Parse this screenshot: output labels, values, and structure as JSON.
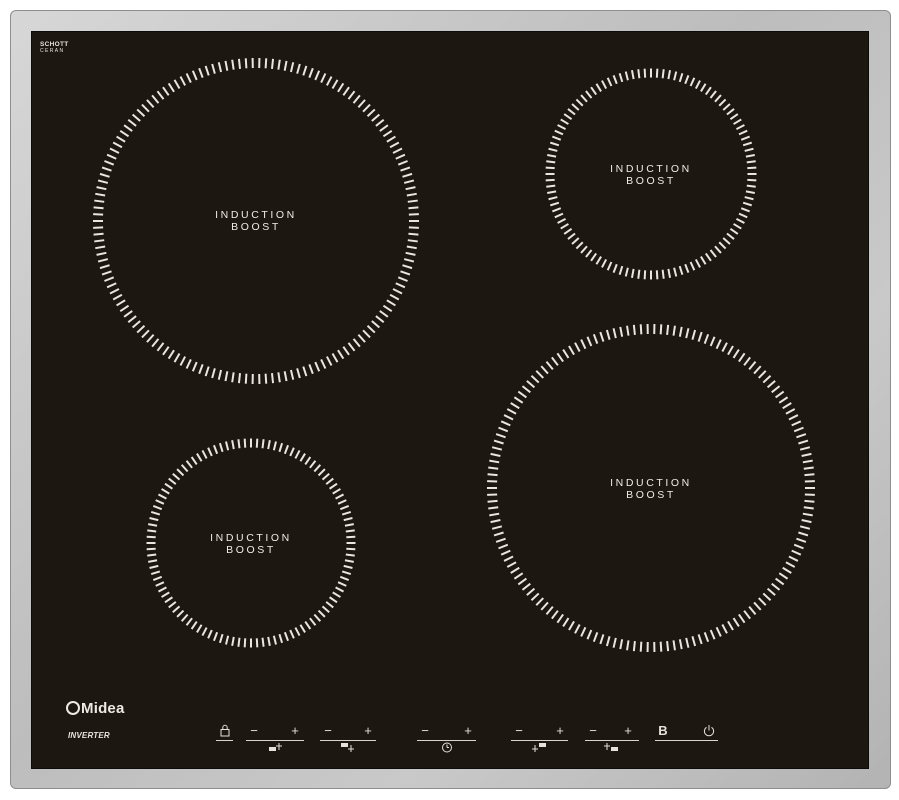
{
  "brand": {
    "glass_maker_line1": "SCHOTT",
    "glass_maker_line2": "CERAN",
    "logo": "Midea",
    "badge": "INVERTER"
  },
  "zones": [
    {
      "id": "rear-left",
      "line1": "INDUCTION",
      "line2": "BOOST"
    },
    {
      "id": "rear-right",
      "line1": "INDUCTION",
      "line2": "BOOST"
    },
    {
      "id": "front-left",
      "line1": "INDUCTION",
      "line2": "BOOST"
    },
    {
      "id": "front-right",
      "line1": "INDUCTION",
      "line2": "BOOST"
    }
  ],
  "controls": {
    "lock_icon": "lock-icon",
    "minus": "−",
    "plus": "+",
    "boost_label": "B",
    "power_icon": "power-icon",
    "timer_icon": "clock-icon",
    "zone_icons": [
      "zone-front-left-icon",
      "zone-rear-left-icon",
      "zone-rear-right-icon",
      "zone-front-right-icon"
    ]
  },
  "colors": {
    "glass": "#1d1712",
    "frame": "#c4c4c4",
    "print": "#e8e3dc"
  }
}
